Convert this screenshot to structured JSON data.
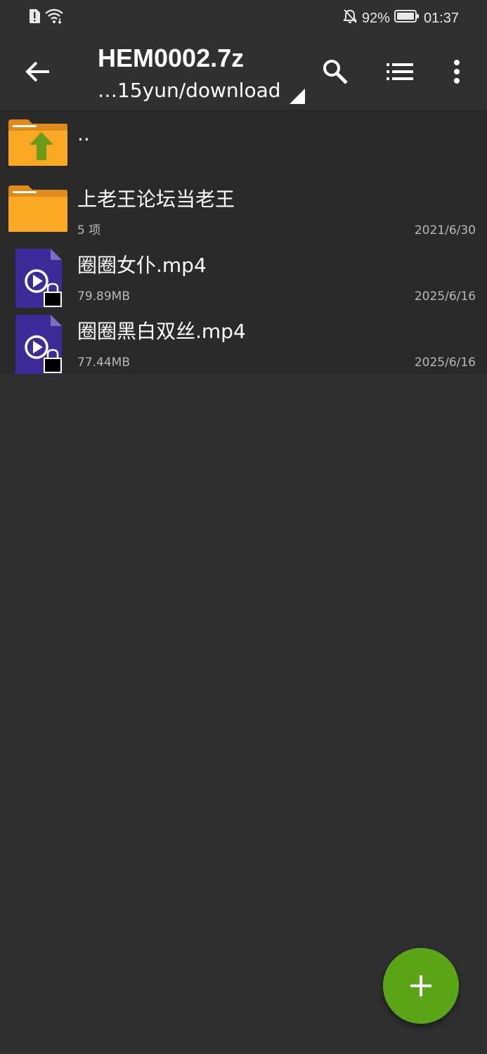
{
  "status_bar": {
    "battery": "92%",
    "time": "01:37"
  },
  "app_bar": {
    "title": "HEM0002.7z",
    "path": "…15yun/download"
  },
  "files": [
    {
      "name": "..",
      "sub": "",
      "date": "",
      "icon": "folder-up-icon"
    },
    {
      "name": "上老王论坛当老王",
      "sub": "5 项",
      "date": "2021/6/30",
      "icon": "folder-icon"
    },
    {
      "name": "圈圈女仆.mp4",
      "sub": "79.89MB",
      "date": "2025/6/16",
      "icon": "locked-video-file-icon"
    },
    {
      "name": "圈圈黑白双丝.mp4",
      "sub": "77.44MB",
      "date": "2025/6/16",
      "icon": "locked-video-file-icon"
    }
  ],
  "colors": {
    "background": "#303030",
    "list_background": "#2a2a2a",
    "folder": "#f9a825",
    "up_arrow": "#6a9c1a",
    "video_file": "#3d2b99",
    "fab": "#5aa617"
  }
}
